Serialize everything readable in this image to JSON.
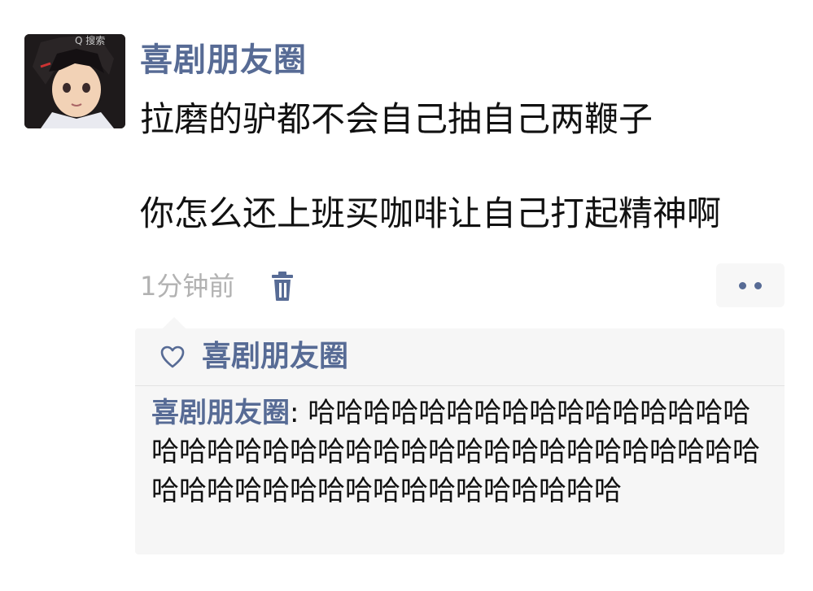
{
  "avatar": {
    "caption": "Q 搜索"
  },
  "post": {
    "username": "喜剧朋友圈",
    "text_line1": "拉磨的驴都不会自己抽自己两鞭子",
    "text_line2": "你怎么还上班买咖啡让自己打起精神啊",
    "timestamp": "1分钟前"
  },
  "likes": {
    "names": "喜剧朋友圈"
  },
  "comments": [
    {
      "author": "喜剧朋友圈",
      "separator": ": ",
      "text": "哈哈哈哈哈哈哈哈哈哈哈哈哈哈哈哈哈哈哈哈哈哈哈哈哈哈哈哈哈哈哈哈哈哈哈哈哈哈哈哈哈哈哈哈哈哈哈哈哈哈哈哈哈哈哈"
    }
  ],
  "colors": {
    "link_blue": "#576b95",
    "text": "#111111",
    "muted": "#b2b2b2",
    "panel_bg": "#f6f6f6"
  },
  "icons": {
    "delete": "trash-icon",
    "more": "more-dots-icon",
    "like": "heart-outline-icon"
  }
}
